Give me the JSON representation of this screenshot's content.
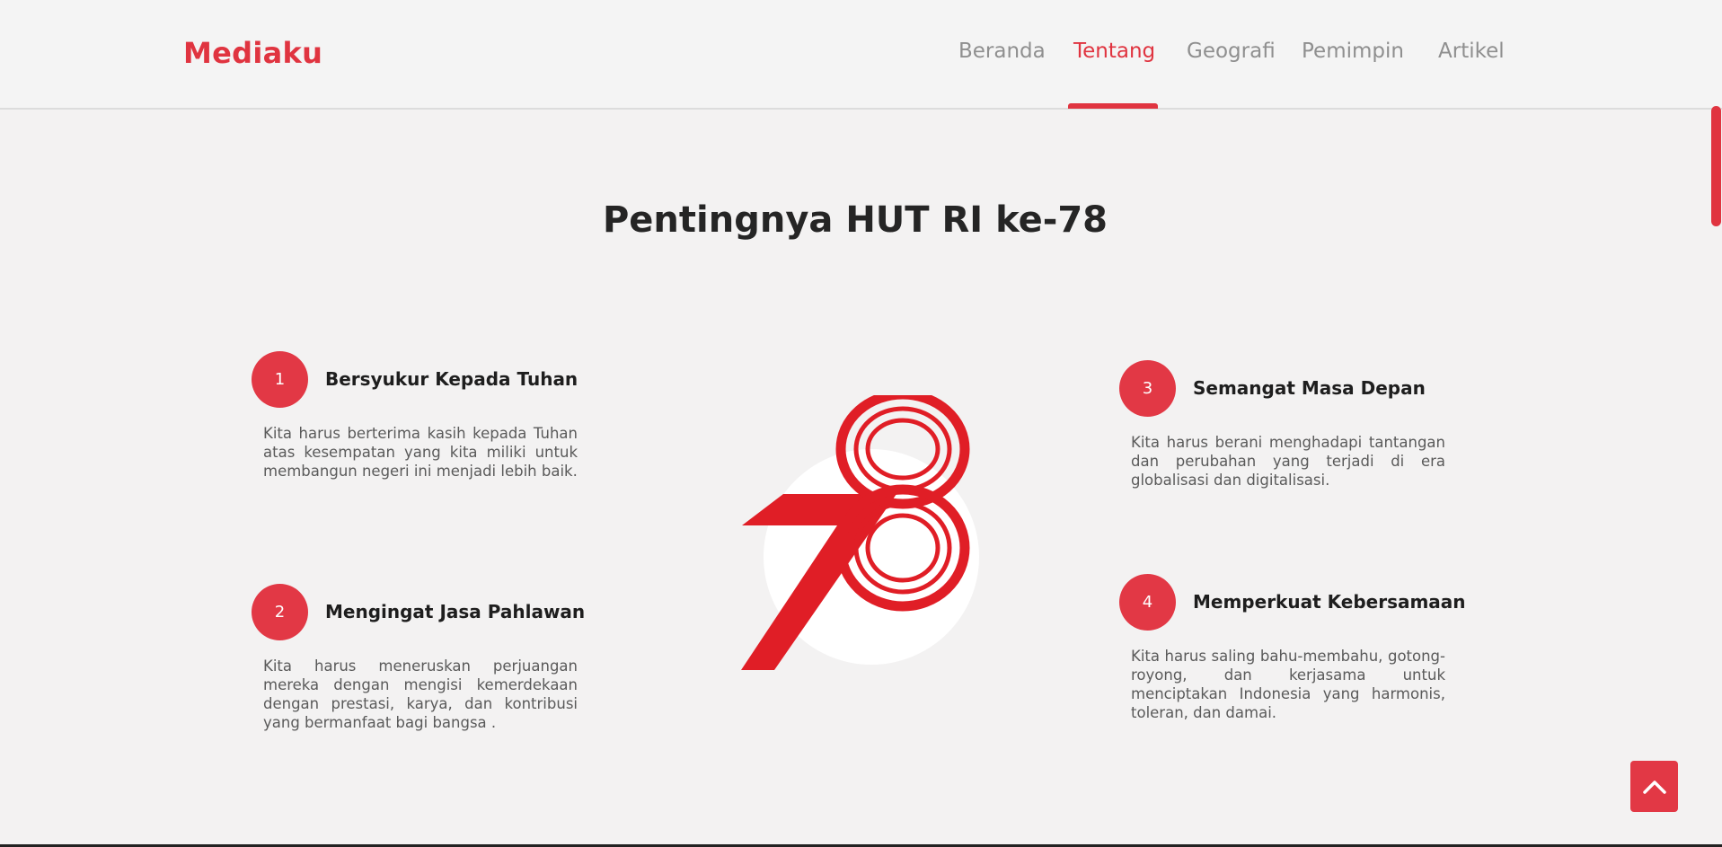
{
  "header": {
    "brand": "Mediaku",
    "nav": [
      {
        "label": "Beranda",
        "active": false
      },
      {
        "label": "Tentang",
        "active": true
      },
      {
        "label": "Geografi",
        "active": false
      },
      {
        "label": "Pemimpin",
        "active": false
      },
      {
        "label": "Artikel",
        "active": false
      }
    ]
  },
  "section": {
    "title": "Pentingnya HUT RI ke-78",
    "points": [
      {
        "number": "1",
        "title": "Bersyukur Kepada Tuhan",
        "description": "Kita harus berterima kasih kepada Tuhan atas kesempatan yang kita miliki untuk membangun negeri ini menjadi lebih baik."
      },
      {
        "number": "2",
        "title": "Mengingat Jasa Pahlawan",
        "description": "Kita harus meneruskan perjuangan mereka dengan mengisi kemerdekaan dengan prestasi, karya, dan kontribusi yang bermanfaat bagi bangsa ."
      },
      {
        "number": "3",
        "title": "Semangat Masa Depan",
        "description": "Kita harus berani menghadapi tantangan dan perubahan yang terjadi di era globalisasi dan digitalisasi."
      },
      {
        "number": "4",
        "title": "Memperkuat Kebersamaan",
        "description": "Kita harus saling bahu-membahu, gotong-royong, dan kerjasama untuk menciptakan Indonesia yang harmonis, toleran, dan damai."
      }
    ],
    "logo_icon": "hut-ri-78-logo"
  },
  "back_to_top_icon": "chevron-up-icon",
  "colors": {
    "accent": "#e03440",
    "background": "#f3f2f2",
    "text": "#252525",
    "muted": "#8f8f8f"
  }
}
